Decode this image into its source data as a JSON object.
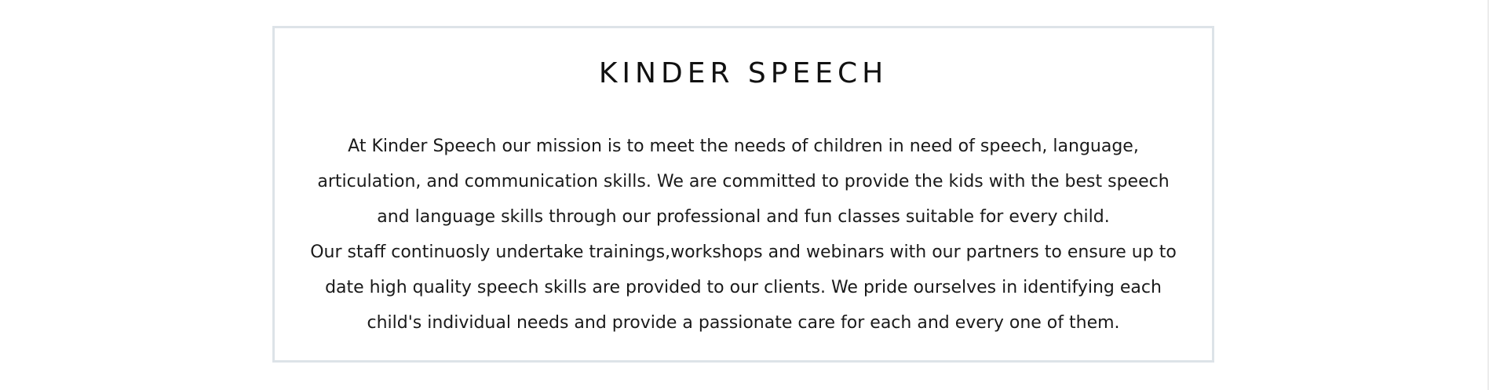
{
  "section": {
    "title": "KINDER SPEECH",
    "paragraphs": [
      "At Kinder Speech our mission is to meet the needs of children in need of speech, language, articulation, and communication skills. We are committed to provide the kids with the best speech and language skills through our professional and fun classes suitable for every child.",
      "Our staff continuosly undertake trainings,workshops and webinars with our partners to ensure up to date high quality speech skills are provided to our clients. We pride ourselves in identifying each child's individual needs and provide a passionate care for each and every one of them."
    ]
  },
  "colors": {
    "border": "#dde3e8",
    "text": "#111111",
    "background": "#ffffff"
  }
}
